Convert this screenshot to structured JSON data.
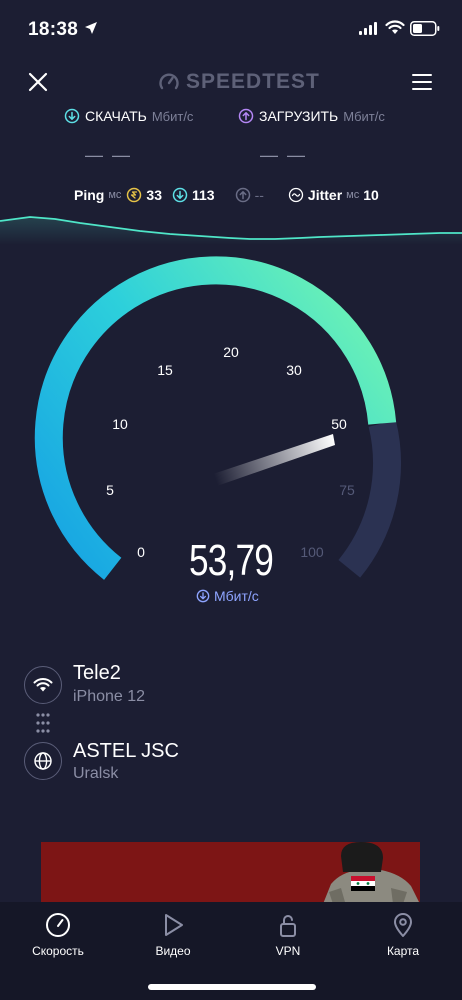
{
  "status_bar": {
    "time": "18:38",
    "icons": [
      "location-arrow-icon",
      "signal-icon",
      "wifi-icon",
      "battery-icon"
    ]
  },
  "header": {
    "brand": "SPEEDTEST",
    "icons": [
      "close-icon",
      "speedtest-logo-icon",
      "menu-icon"
    ]
  },
  "metrics": {
    "download": {
      "label": "СКАЧАТЬ",
      "unit": "Мбит/с",
      "value": "— —"
    },
    "upload": {
      "label": "ЗАГРУЗИТЬ",
      "unit": "Мбит/с",
      "value": "— —"
    }
  },
  "ping_row": {
    "ping_label": "Ping",
    "ping_unit": "мс",
    "idle_value": "33",
    "download_value": "113",
    "upload_value": "--",
    "jitter_label": "Jitter",
    "jitter_unit": "мс",
    "jitter_value": "10"
  },
  "gauge": {
    "ticks": [
      "0",
      "5",
      "10",
      "15",
      "20",
      "30",
      "50",
      "75",
      "100"
    ],
    "current_speed": "53,79",
    "unit": "Мбит/с"
  },
  "connection": {
    "provider": "Tele2",
    "device": "iPhone 12",
    "server": "ASTEL JSC",
    "location": "Uralsk"
  },
  "tabs": [
    {
      "label": "Скорость",
      "icon": "speedometer-icon"
    },
    {
      "label": "Видео",
      "icon": "play-icon"
    },
    {
      "label": "VPN",
      "icon": "lock-icon"
    },
    {
      "label": "Карта",
      "icon": "map-pin-icon"
    }
  ],
  "colors": {
    "background": "#1c1e33",
    "accent_teal": "#4fe6c8",
    "accent_blue": "#1fb0e6",
    "download_icon": "#5de0e6",
    "upload_icon": "#b487f5",
    "idle_icon": "#e6c347"
  }
}
